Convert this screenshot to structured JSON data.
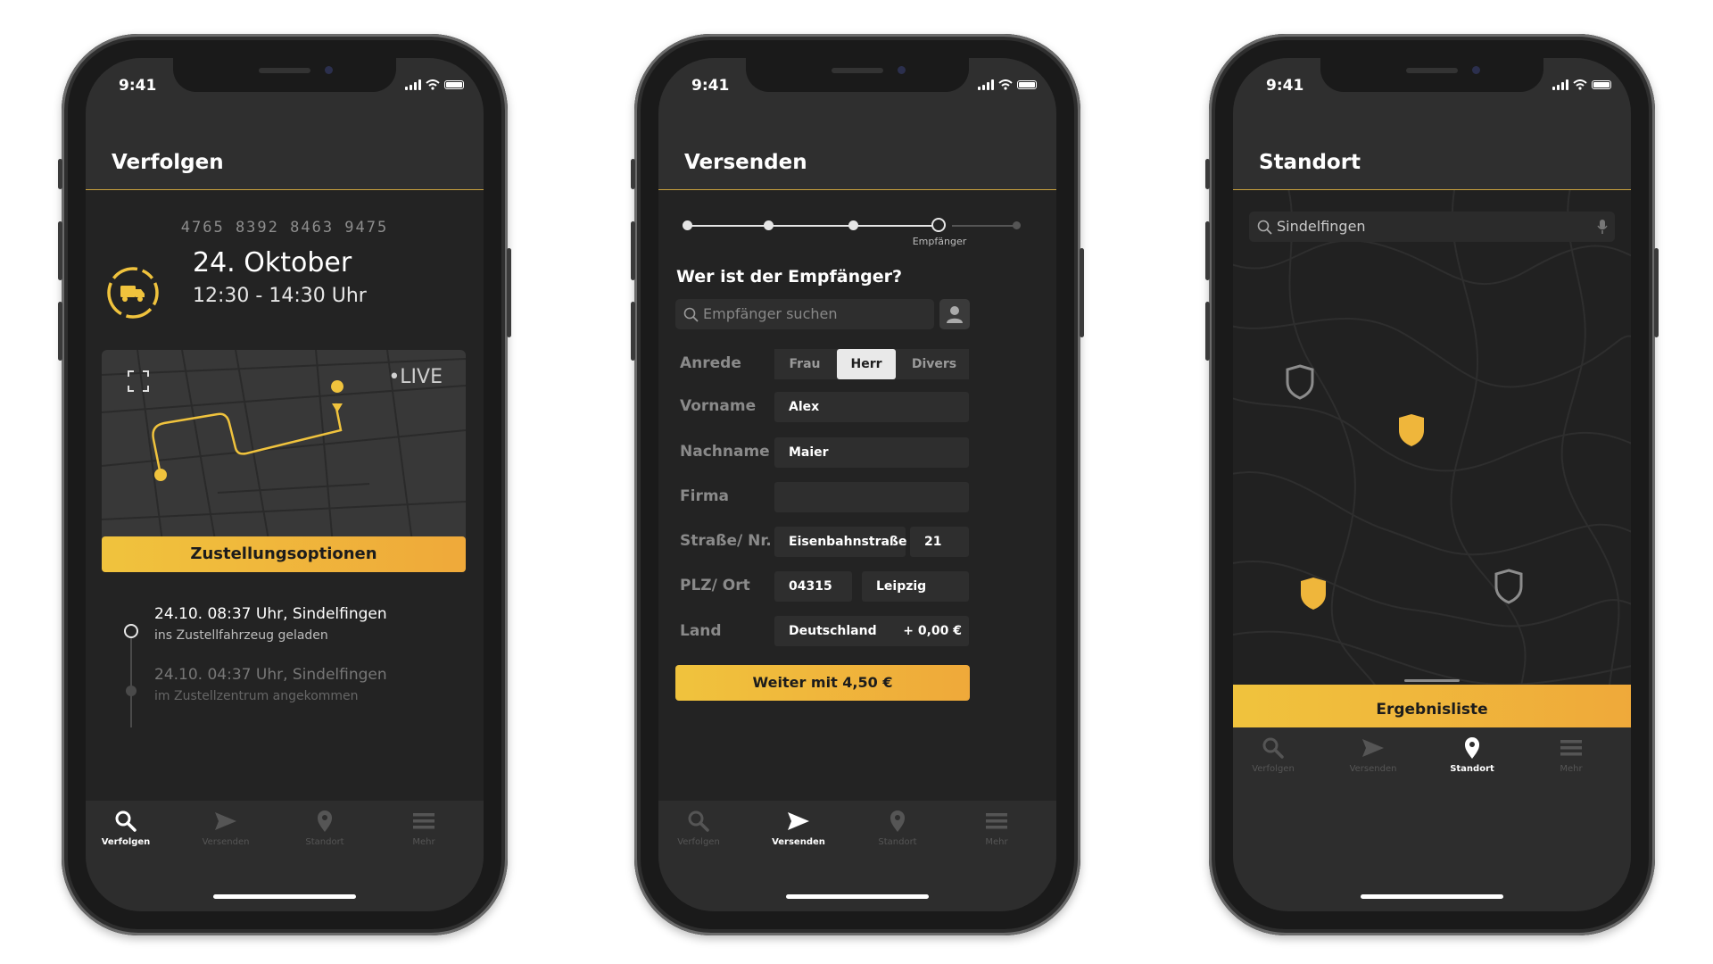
{
  "colors": {
    "accent": "#f0c33d",
    "background": "#232323",
    "header": "#2f2f2f"
  },
  "status": {
    "time": "9:41"
  },
  "tabs": {
    "search": {
      "label": "Verfolgen",
      "icon": "search-icon"
    },
    "send": {
      "label": "Versenden",
      "icon": "send-icon"
    },
    "location": {
      "label": "Standort",
      "icon": "location-pin-icon"
    },
    "more": {
      "label": "Mehr",
      "icon": "menu-icon"
    }
  },
  "phone1": {
    "title": "Verfolgen",
    "tracking_number": "4765 8392 8463 9475",
    "date": "24. Oktober",
    "time_window": "12:30 - 14:30 Uhr",
    "live_label": "•LIVE",
    "button": "Zustellungsoptionen",
    "events": [
      {
        "title": "24.10. 08:37 Uhr, Sindelfingen",
        "subtitle": "ins Zustellfahrzeug geladen"
      },
      {
        "title": "24.10. 04:37 Uhr, Sindelfingen",
        "subtitle": "im Zustellzentrum angekommen"
      }
    ]
  },
  "phone2": {
    "title": "Versenden",
    "step_label": "Empfänger",
    "question": "Wer ist der Empfänger?",
    "search_placeholder": "Empfänger suchen",
    "labels": {
      "salutation": "Anrede",
      "firstname": "Vorname",
      "lastname": "Nachname",
      "company": "Firma",
      "street": "Straße/ Nr.",
      "zipcity": "PLZ/ Ort",
      "country": "Land"
    },
    "salutation_options": [
      "Frau",
      "Herr",
      "Divers"
    ],
    "values": {
      "firstname": "Alex",
      "lastname": "Maier",
      "company": "",
      "street": "Eisenbahnstraße",
      "number": "21",
      "zip": "04315",
      "city": "Leipzig",
      "country": "Deutschland",
      "country_fee": "+ 0,00 €"
    },
    "button": "Weiter mit 4,50 €"
  },
  "phone3": {
    "title": "Standort",
    "search_value": "Sindelfingen",
    "sheet_label": "Ergebnisliste"
  }
}
